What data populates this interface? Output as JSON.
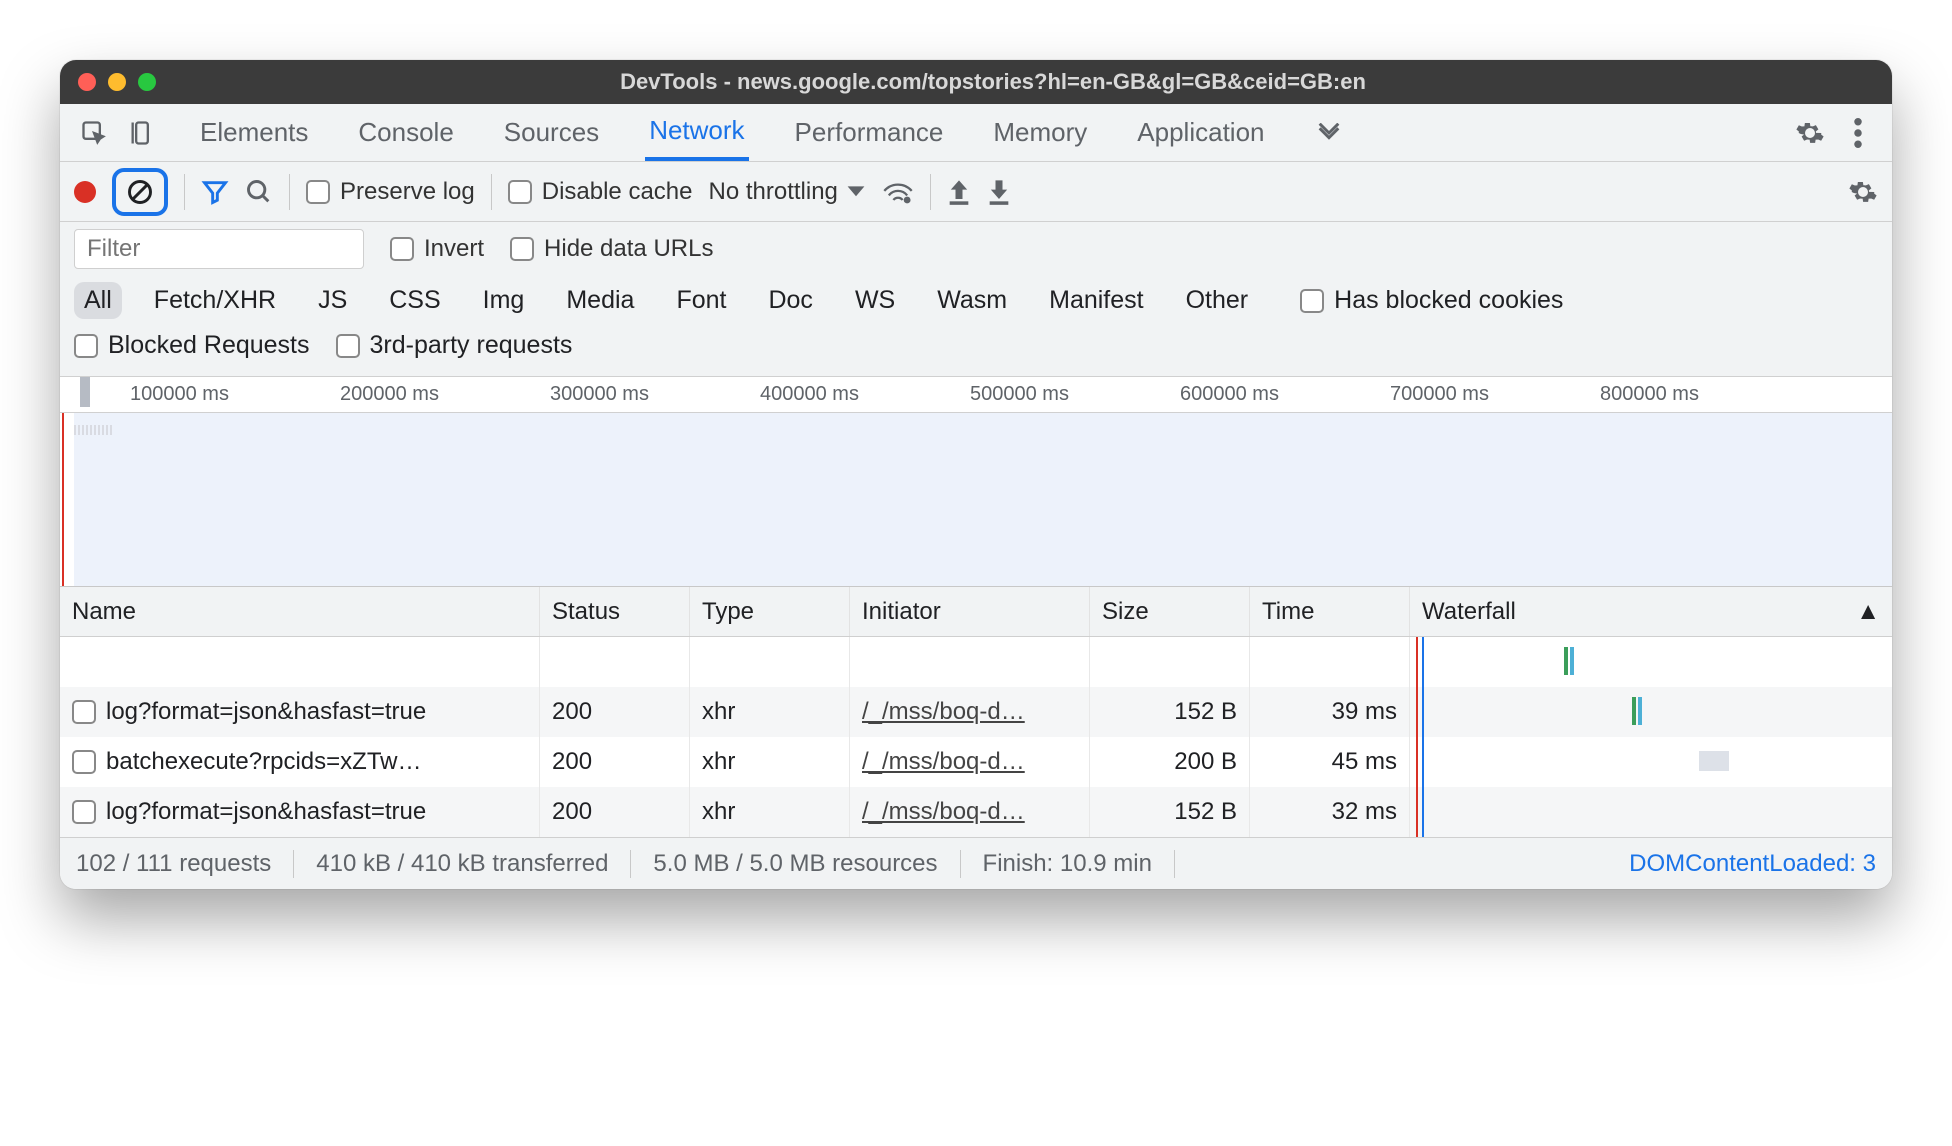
{
  "window": {
    "title": "DevTools - news.google.com/topstories?hl=en-GB&gl=GB&ceid=GB:en"
  },
  "tabs": {
    "items": [
      "Elements",
      "Console",
      "Sources",
      "Network",
      "Performance",
      "Memory",
      "Application"
    ],
    "active": "Network"
  },
  "toolbar": {
    "preserve_log": "Preserve log",
    "disable_cache": "Disable cache",
    "throttling": "No throttling"
  },
  "filter": {
    "placeholder": "Filter",
    "invert": "Invert",
    "hide_data_urls": "Hide data URLs"
  },
  "types": {
    "items": [
      "All",
      "Fetch/XHR",
      "JS",
      "CSS",
      "Img",
      "Media",
      "Font",
      "Doc",
      "WS",
      "Wasm",
      "Manifest",
      "Other"
    ],
    "active": "All",
    "has_blocked_cookies": "Has blocked cookies",
    "blocked_requests": "Blocked Requests",
    "third_party": "3rd-party requests"
  },
  "timeline": {
    "ticks": [
      "100000 ms",
      "200000 ms",
      "300000 ms",
      "400000 ms",
      "500000 ms",
      "600000 ms",
      "700000 ms",
      "800000 ms"
    ]
  },
  "columns": {
    "name": "Name",
    "status": "Status",
    "type": "Type",
    "initiator": "Initiator",
    "size": "Size",
    "time": "Time",
    "waterfall": "Waterfall"
  },
  "requests": [
    {
      "name": "log?format=json&hasfast=true",
      "status": "200",
      "type": "xhr",
      "initiator": "/_/mss/boq-d…",
      "size": "152 B",
      "time": "39 ms",
      "wpos": 32
    },
    {
      "name": "batchexecute?rpcids=xZTw…",
      "status": "200",
      "type": "xhr",
      "initiator": "/_/mss/boq-d…",
      "size": "200 B",
      "time": "45 ms",
      "wpos": 46
    },
    {
      "name": "log?format=json&hasfast=true",
      "status": "200",
      "type": "xhr",
      "initiator": "/_/mss/boq-d…",
      "size": "152 B",
      "time": "32 ms",
      "wpos": 60
    }
  ],
  "status": {
    "requests": "102 / 111 requests",
    "transferred": "410 kB / 410 kB transferred",
    "resources": "5.0 MB / 5.0 MB resources",
    "finish": "Finish: 10.9 min",
    "dcl": "DOMContentLoaded: 3"
  }
}
